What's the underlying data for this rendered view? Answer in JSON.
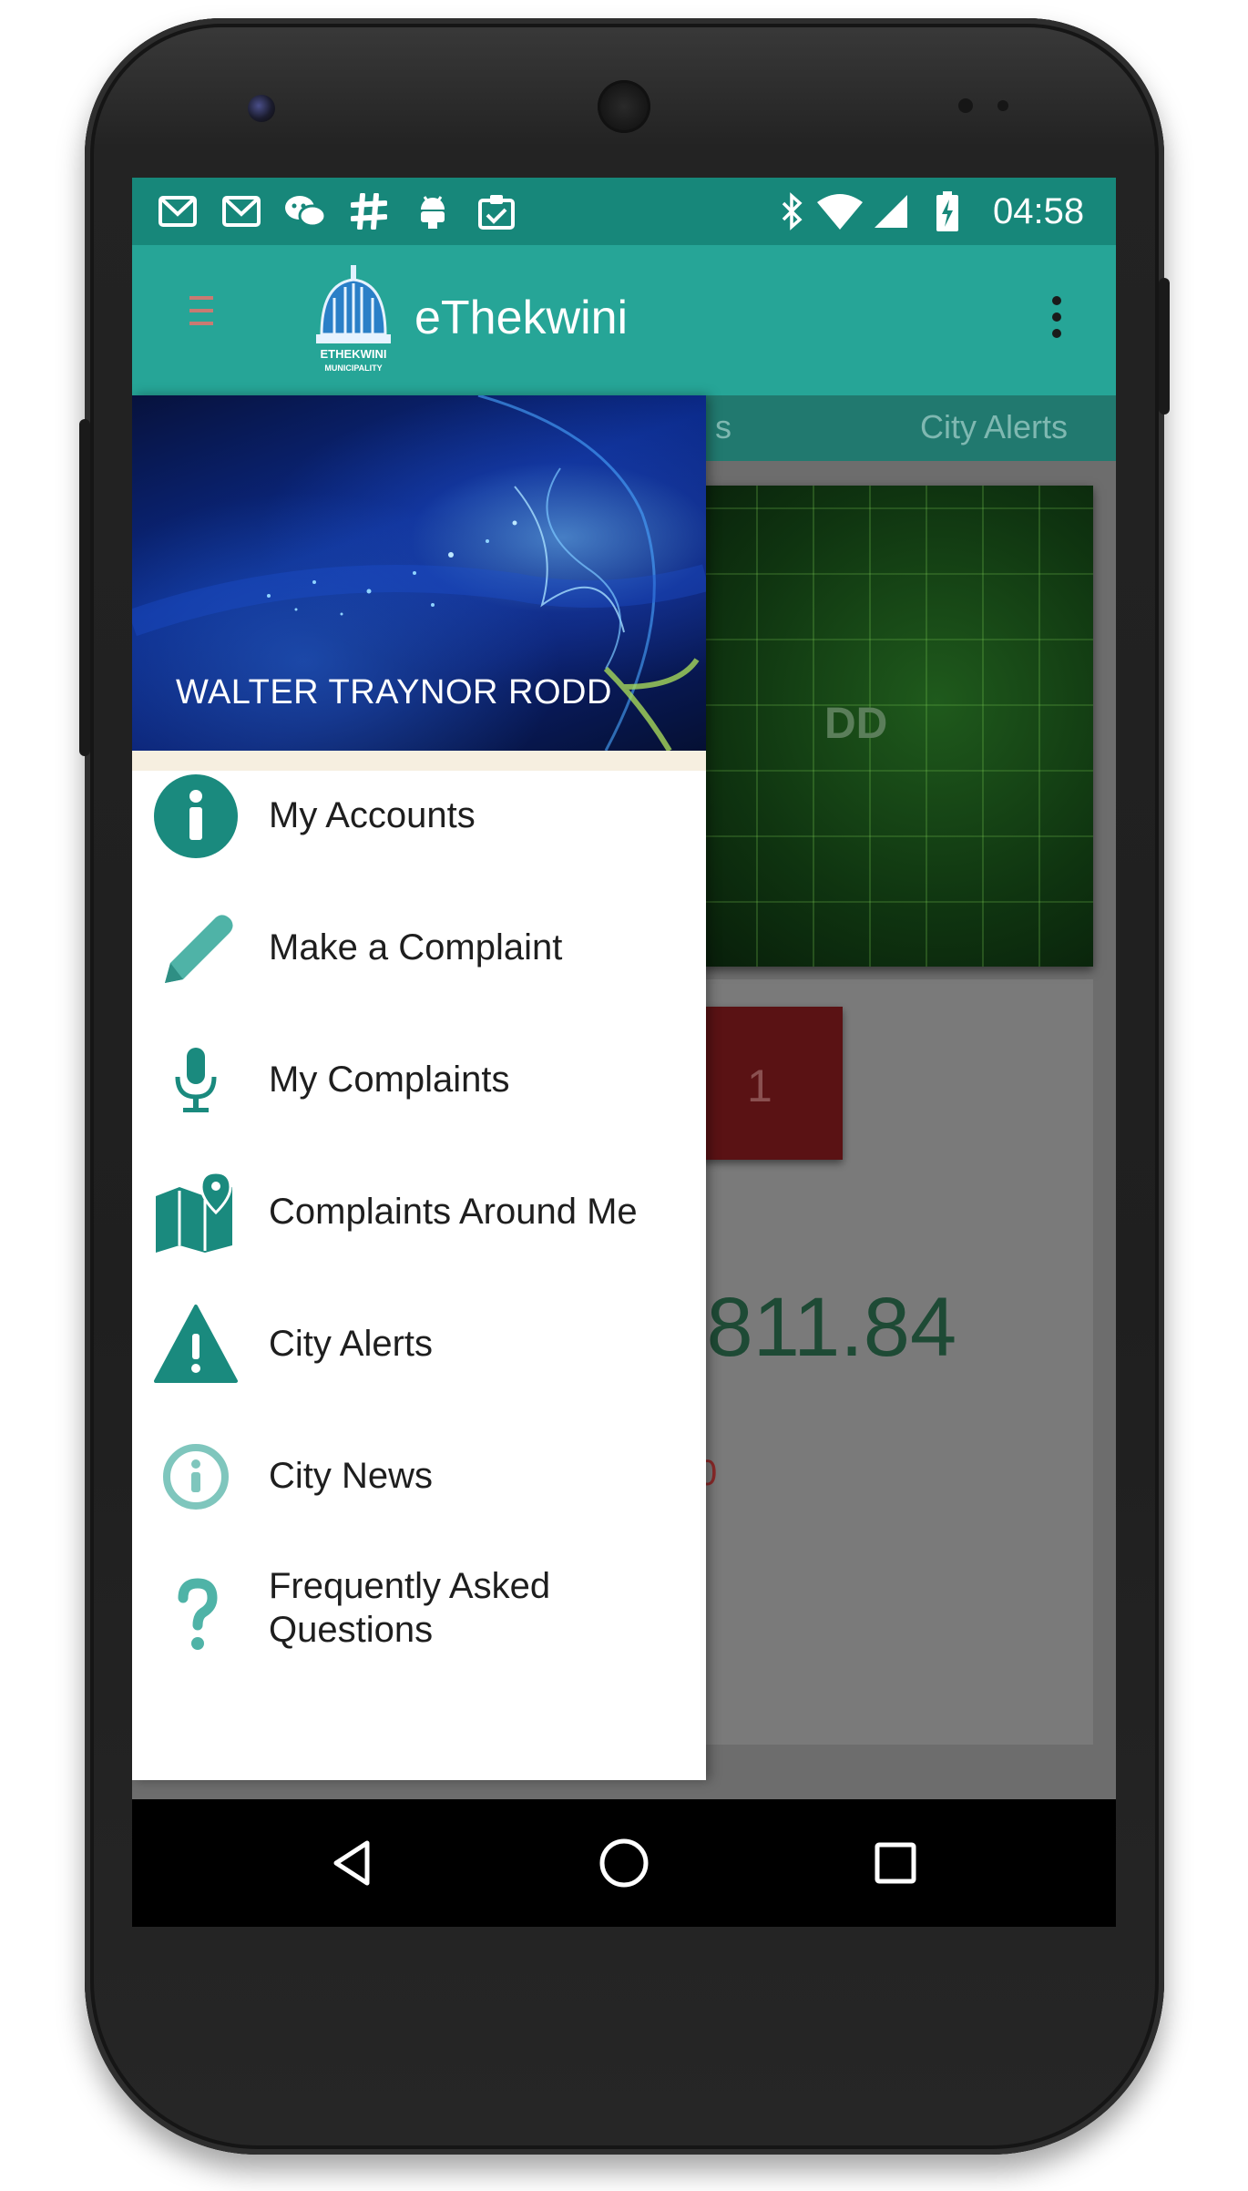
{
  "status_bar": {
    "time": "04:58",
    "left_icons": [
      "gmail-icon",
      "gmail-icon",
      "wechat-icon",
      "slack-icon",
      "android-icon",
      "clipboard-check-icon"
    ],
    "right_icons": [
      "bluetooth-icon",
      "wifi-icon",
      "cell-signal-icon",
      "battery-charging-icon"
    ]
  },
  "app_bar": {
    "title": "eThekwini",
    "logo_text": "ETHEKWINI MUNICIPALITY",
    "menu_icon": "hamburger-menu-icon",
    "overflow_icon": "more-vert-icon"
  },
  "tabs": [
    "s",
    "City Alerts"
  ],
  "background_content": {
    "hero_text_fragment": "DD",
    "count_value": "1",
    "amount_fragment": ",811.84",
    "red_fragment": "0"
  },
  "drawer": {
    "user_name": "WALTER TRAYNOR RODD",
    "items": [
      {
        "label": "My Accounts",
        "icon": "info-circle-icon"
      },
      {
        "label": "Make a Complaint",
        "icon": "pencil-icon"
      },
      {
        "label": "My Complaints",
        "icon": "microphone-icon"
      },
      {
        "label": "Complaints Around Me",
        "icon": "map-pin-icon"
      },
      {
        "label": "City Alerts",
        "icon": "warning-triangle-icon"
      },
      {
        "label": "City News",
        "icon": "info-outline-icon"
      },
      {
        "label_line1": "Frequently Asked",
        "label_line2": "Questions",
        "icon": "question-mark-icon"
      }
    ]
  },
  "nav_bar": {
    "back": "back-triangle-icon",
    "home": "home-circle-icon",
    "recents": "recents-square-icon"
  },
  "colors": {
    "status_bar": "#17877a",
    "app_bar": "#26a597",
    "icon_teal": "#1a8a7e",
    "drawer_bg": "#ffffff",
    "scrim_bg": "#6d6d6d"
  }
}
